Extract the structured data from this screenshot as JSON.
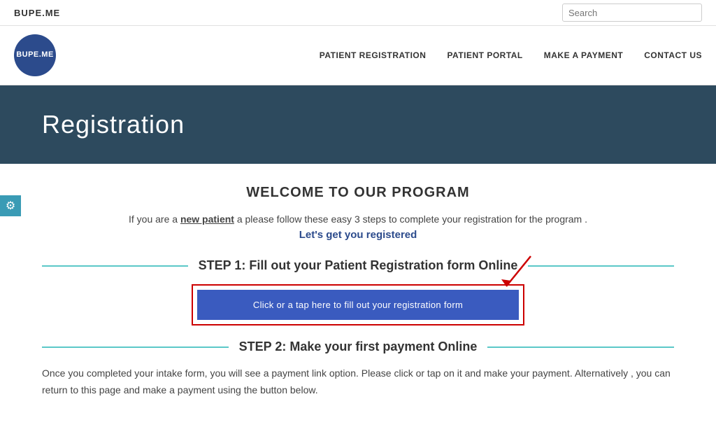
{
  "topbar": {
    "brand": "BUPE.ME",
    "search_placeholder": "Search"
  },
  "navbar": {
    "logo_text": "BUPE.ME",
    "links": [
      {
        "id": "patient-registration",
        "label": "PATIENT REGISTRATION"
      },
      {
        "id": "patient-portal",
        "label": "PATIENT PORTAL"
      },
      {
        "id": "make-payment",
        "label": "MAKE A PAYMENT"
      },
      {
        "id": "contact-us",
        "label": "CONTACT US"
      }
    ]
  },
  "hero": {
    "title": "Registration"
  },
  "main": {
    "welcome_heading": "WELCOME TO OUR PROGRAM",
    "intro_text_prefix": "If you are a ",
    "intro_text_link": "new patient",
    "intro_text_suffix": " a please follow these easy 3 steps to complete your registration for the program .",
    "lets_get_registered": "Let's get you registered",
    "step1_heading": "STEP 1: Fill out your Patient Registration form Online",
    "reg_button_label": "Click or a tap here to fill out your registration form",
    "step2_heading": "STEP 2: Make your first payment Online",
    "step2_text": "Once you completed your intake form, you will see a payment link option. Please click or tap on it and make your payment. Alternatively , you can  return to this page and make a payment using the button below."
  },
  "settings": {
    "icon": "⚙"
  }
}
